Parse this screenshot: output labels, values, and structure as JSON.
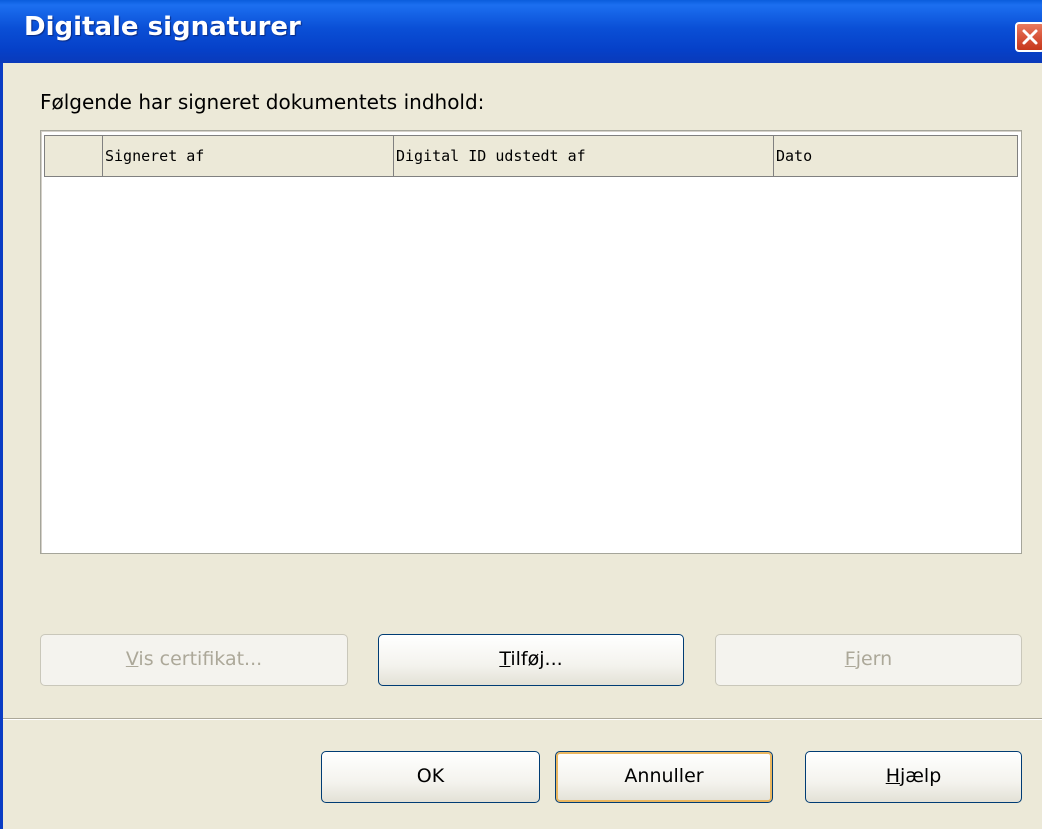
{
  "window": {
    "title": "Digitale signaturer"
  },
  "heading": "Følgende har signeret dokumentets indhold:",
  "table": {
    "columns": [
      "",
      "Signeret af",
      "Digital ID udstedt af",
      "Dato"
    ],
    "rows": []
  },
  "actions": {
    "view_cert": {
      "prefix": "",
      "accel": "V",
      "suffix": "is certifikat..."
    },
    "add": {
      "prefix": "",
      "accel": "T",
      "suffix": "ilføj..."
    },
    "remove": {
      "prefix": "",
      "accel": "F",
      "suffix": "jern"
    }
  },
  "footer": {
    "ok": "OK",
    "cancel": "Annuller",
    "help": {
      "prefix": "",
      "accel": "H",
      "suffix": "jælp"
    }
  },
  "icons": {
    "close": "close-icon"
  },
  "colors": {
    "titlebar": "#0a4fd6",
    "close_button": "#d8543a",
    "dialog_bg": "#ece9d8",
    "default_button_focus": "#e9b660",
    "disabled_text": "#aca899"
  }
}
